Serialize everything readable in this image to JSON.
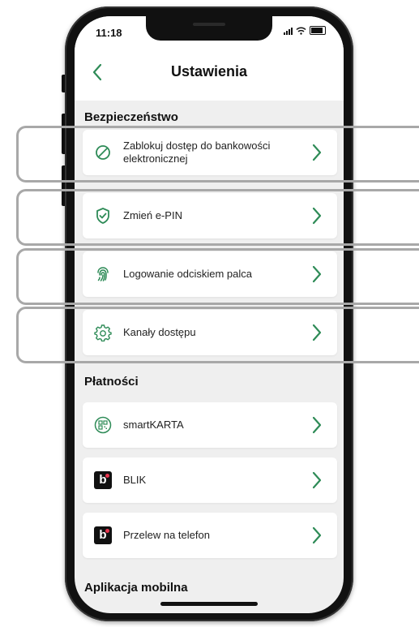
{
  "status_bar": {
    "time": "11:18"
  },
  "header": {
    "title": "Ustawienia"
  },
  "sections": {
    "security": {
      "title": "Bezpieczeństwo",
      "items": [
        {
          "label": "Zablokuj dostęp do bankowości elektronicznej",
          "icon": "block-icon"
        },
        {
          "label": "Zmień e-PIN",
          "icon": "shield-check-icon"
        },
        {
          "label": "Logowanie odciskiem palca",
          "icon": "fingerprint-icon"
        },
        {
          "label": "Kanały dostępu",
          "icon": "gear-icon"
        }
      ]
    },
    "payments": {
      "title": "Płatności",
      "items": [
        {
          "label": "smartKARTA",
          "icon": "qr-code-icon"
        },
        {
          "label": "BLIK",
          "icon": "blik-logo-icon"
        },
        {
          "label": "Przelew na telefon",
          "icon": "blik-logo-icon"
        }
      ]
    },
    "mobile_app": {
      "title": "Aplikacja mobilna"
    }
  },
  "colors": {
    "accent": "#2e8b57",
    "background": "#efefef",
    "blik_dot": "#e8344e"
  }
}
